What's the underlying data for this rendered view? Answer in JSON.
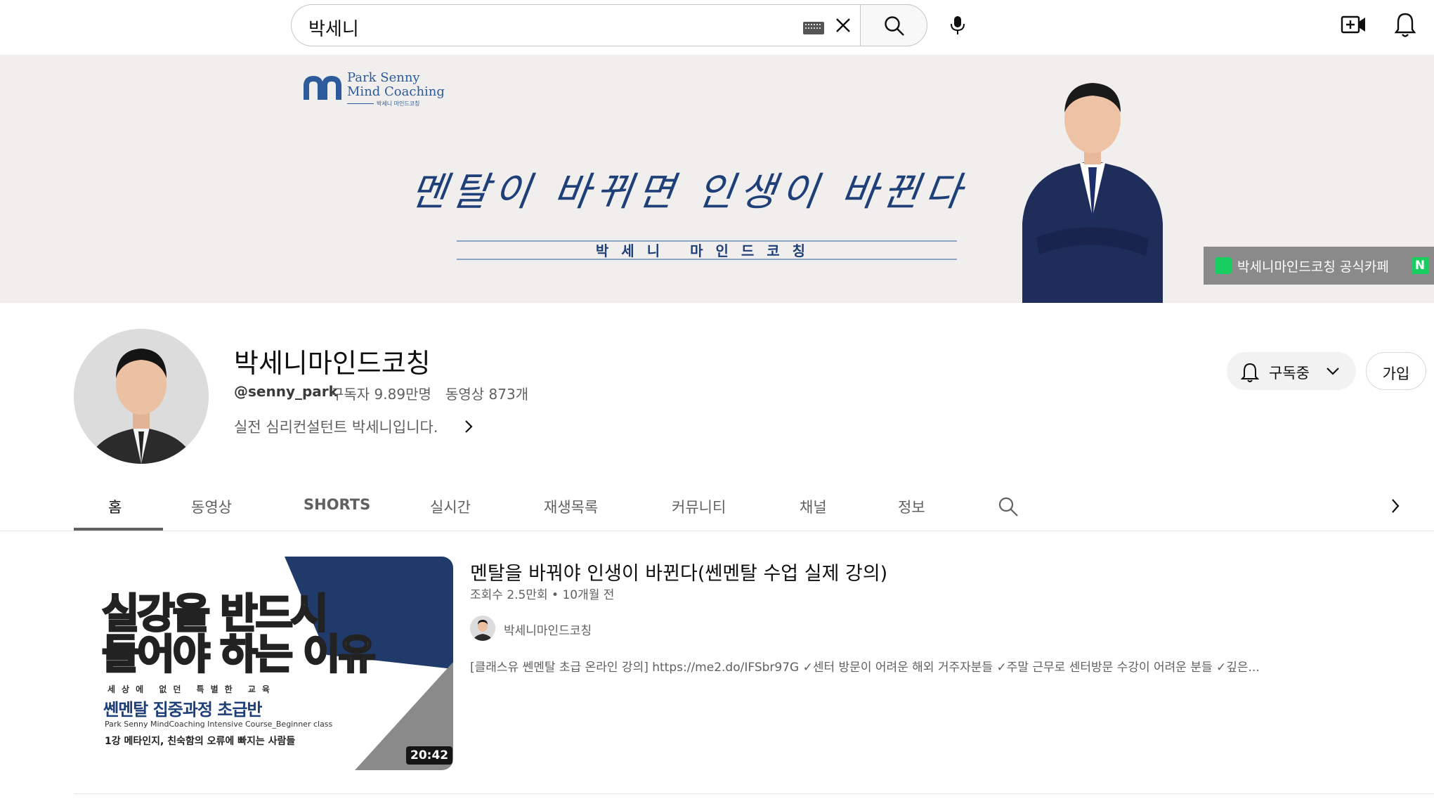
{
  "search": {
    "query": "박세니"
  },
  "banner": {
    "brand_line1": "Park Senny",
    "brand_line2": "Mind Coaching",
    "brand_line3": "박세니 마인드코칭",
    "slogan": "멘탈이 바뀌면 인생이 바뀐다",
    "subtitle": "박세니 마인드코칭",
    "cafe_link": "박세니마인드코칭 공식카페",
    "naver_letter": "N"
  },
  "channel": {
    "name": "박세니마인드코칭",
    "handle": "@senny_park",
    "subscribers": "구독자 9.89만명",
    "video_count": "동영상 873개",
    "description": "실전 심리컨설턴트 박세니입니다.",
    "subscribe_label": "구독중",
    "join_label": "가입"
  },
  "tabs": [
    {
      "label": "홈",
      "active": true
    },
    {
      "label": "동영상"
    },
    {
      "label": "SHORTS"
    },
    {
      "label": "실시간"
    },
    {
      "label": "재생목록"
    },
    {
      "label": "커뮤니티"
    },
    {
      "label": "채널"
    },
    {
      "label": "정보"
    }
  ],
  "featured": {
    "thumb_title_1": "실강을 반드시",
    "thumb_title_2": "들어야 하는 이유",
    "thumb_small": "세상에 없던 특별한 교육",
    "thumb_course": "쎈멘탈 집중과정 초급반",
    "thumb_eng": "Park Senny MindCoaching Intensive Course_Beginner class",
    "thumb_lesson": "1강 메타인지, 친숙함의 오류에 빠지는 사람들",
    "duration": "20:42",
    "title": "멘탈을 바꿔야 인생이 바뀐다(쎈멘탈 수업 실제 강의)",
    "meta": "조회수 2.5만회 • 10개월 전",
    "owner": "박세니마인드코칭",
    "description": "[클래스유 쎈멘탈 초급 온라인 강의] https://me2.do/IFSbr97G ✓센터 방문이 어려운 해외 거주자분들 ✓주말 근무로 센터방문 수강이 어려운 분들 ✓깊은..."
  },
  "colors": {
    "accent": "#1e3f78",
    "cafe_green": "#19ce60",
    "banner_bg": "#f1efee"
  }
}
